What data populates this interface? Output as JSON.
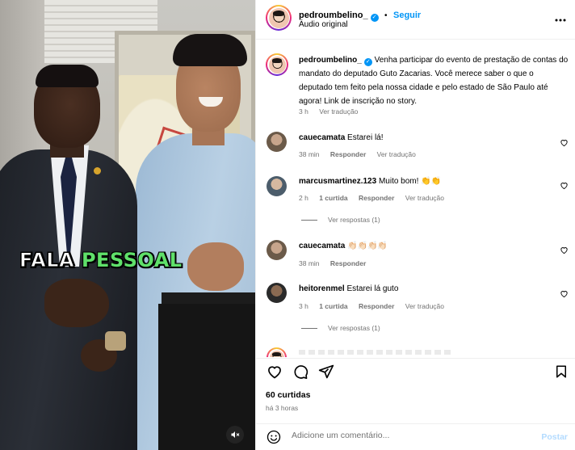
{
  "video": {
    "caption_word1": "FALA",
    "caption_word2": "PESSOAL",
    "caption_color_green": "#5fe06a"
  },
  "header": {
    "username": "pedroumbelino_",
    "follow_label": "Seguir",
    "separator": "•",
    "audio": "Áudio original",
    "more_icon": "more-horizontal-icon"
  },
  "post": {
    "username": "pedroumbelino_",
    "text": "Venha participar do evento de prestação de contas do mandato do deputado Guto Zacarias. Você merece saber o que o deputado tem feito pela nossa cidade e pelo estado de São Paulo até agora! Link de inscrição no story.",
    "time": "3 h",
    "see_translation": "Ver tradução"
  },
  "comments": [
    {
      "username": "cauecamata",
      "text": "Estarei lá!",
      "time": "38 min",
      "likes": "",
      "reply": "Responder",
      "translation": "Ver tradução",
      "avatar_color": "#7a6a5a"
    },
    {
      "username": "marcusmartinez.123",
      "text": "Muito bom! 👏👏",
      "time": "2 h",
      "likes": "1 curtida",
      "reply": "Responder",
      "translation": "Ver tradução",
      "view_replies": "Ver respostas (1)",
      "avatar_color": "#6d7b84"
    },
    {
      "username": "cauecamata",
      "text": "👏🏻👏🏻👏🏻👏🏻",
      "time": "38 min",
      "likes": "",
      "reply": "Responder",
      "translation": "",
      "avatar_color": "#7a6a5a"
    },
    {
      "username": "heitorenmel",
      "text": "Estarei lá guto",
      "time": "3 h",
      "likes": "1 curtida",
      "reply": "Responder",
      "translation": "Ver tradução",
      "view_replies": "Ver respostas (1)",
      "avatar_color": "#3b3b3b"
    }
  ],
  "actions": {
    "likes": "60 curtidas",
    "time_ago": "há 3 horas"
  },
  "add_comment": {
    "placeholder": "Adicione um comentário...",
    "post_label": "Postar",
    "emoji_icon": "smiley-icon"
  },
  "colors": {
    "accent_blue": "#0095f6",
    "muted_text": "#737373",
    "post_disabled": "#b3dbff"
  }
}
